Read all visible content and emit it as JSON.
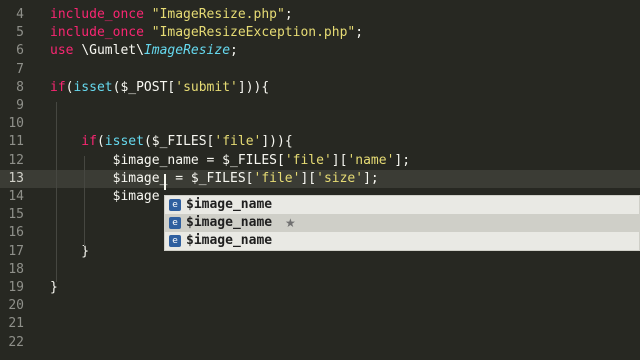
{
  "editor": {
    "lines": [
      {
        "num": "4",
        "tokens": [
          {
            "t": "include_once ",
            "c": "kw"
          },
          {
            "t": "\"ImageResize.php\"",
            "c": "str"
          },
          {
            "t": ";",
            "c": "var"
          }
        ]
      },
      {
        "num": "5",
        "tokens": [
          {
            "t": "include_once ",
            "c": "kw"
          },
          {
            "t": "\"ImageResizeException.php\"",
            "c": "str"
          },
          {
            "t": ";",
            "c": "var"
          }
        ]
      },
      {
        "num": "6",
        "tokens": [
          {
            "t": "use ",
            "c": "kw"
          },
          {
            "t": "\\Gumlet\\",
            "c": "var"
          },
          {
            "t": "ImageResize",
            "c": "cls"
          },
          {
            "t": ";",
            "c": "var"
          }
        ]
      },
      {
        "num": "7",
        "tokens": []
      },
      {
        "num": "8",
        "tokens": [
          {
            "t": "if",
            "c": "kw"
          },
          {
            "t": "(",
            "c": "var"
          },
          {
            "t": "isset",
            "c": "fn"
          },
          {
            "t": "($_POST[",
            "c": "var"
          },
          {
            "t": "'submit'",
            "c": "str"
          },
          {
            "t": "])){",
            "c": "var"
          }
        ]
      },
      {
        "num": "9",
        "tokens": []
      },
      {
        "num": "10",
        "tokens": []
      },
      {
        "num": "11",
        "tokens": [
          {
            "t": "    if",
            "c": "kw"
          },
          {
            "t": "(",
            "c": "var"
          },
          {
            "t": "isset",
            "c": "fn"
          },
          {
            "t": "($_FILES[",
            "c": "var"
          },
          {
            "t": "'file'",
            "c": "str"
          },
          {
            "t": "])){",
            "c": "var"
          }
        ]
      },
      {
        "num": "12",
        "tokens": [
          {
            "t": "        $image_name = $_FILES[",
            "c": "var"
          },
          {
            "t": "'file'",
            "c": "str"
          },
          {
            "t": "][",
            "c": "var"
          },
          {
            "t": "'name'",
            "c": "str"
          },
          {
            "t": "];",
            "c": "var"
          }
        ]
      },
      {
        "num": "13",
        "tokens": [
          {
            "t": "        $image_ = $_FILES[",
            "c": "var"
          },
          {
            "t": "'file'",
            "c": "str"
          },
          {
            "t": "][",
            "c": "var"
          },
          {
            "t": "'size'",
            "c": "str"
          },
          {
            "t": "];",
            "c": "var"
          }
        ]
      },
      {
        "num": "14",
        "tokens": [
          {
            "t": "        $image",
            "c": "var"
          }
        ]
      },
      {
        "num": "15",
        "tokens": []
      },
      {
        "num": "16",
        "tokens": []
      },
      {
        "num": "17",
        "tokens": [
          {
            "t": "    }",
            "c": "var"
          }
        ]
      },
      {
        "num": "18",
        "tokens": []
      },
      {
        "num": "19",
        "tokens": [
          {
            "t": "}",
            "c": "var"
          }
        ]
      },
      {
        "num": "20",
        "tokens": []
      },
      {
        "num": "21",
        "tokens": []
      },
      {
        "num": "22",
        "tokens": []
      }
    ],
    "current_line": "13"
  },
  "autocomplete": {
    "items": [
      {
        "icon": "variable-icon",
        "icon_glyph": "e",
        "label": "$image_name",
        "starred": false
      },
      {
        "icon": "variable-icon",
        "icon_glyph": "e",
        "label": "$image_name",
        "starred": true,
        "star": "★"
      },
      {
        "icon": "variable-icon",
        "icon_glyph": "e",
        "label": "$image_name",
        "starred": false
      }
    ],
    "selected_index": 1
  },
  "colors": {
    "background": "#272822",
    "keyword": "#f92672",
    "function": "#66d9ef",
    "string": "#e6db74",
    "text": "#f8f8f2",
    "popup_bg": "#e9e9e4"
  }
}
